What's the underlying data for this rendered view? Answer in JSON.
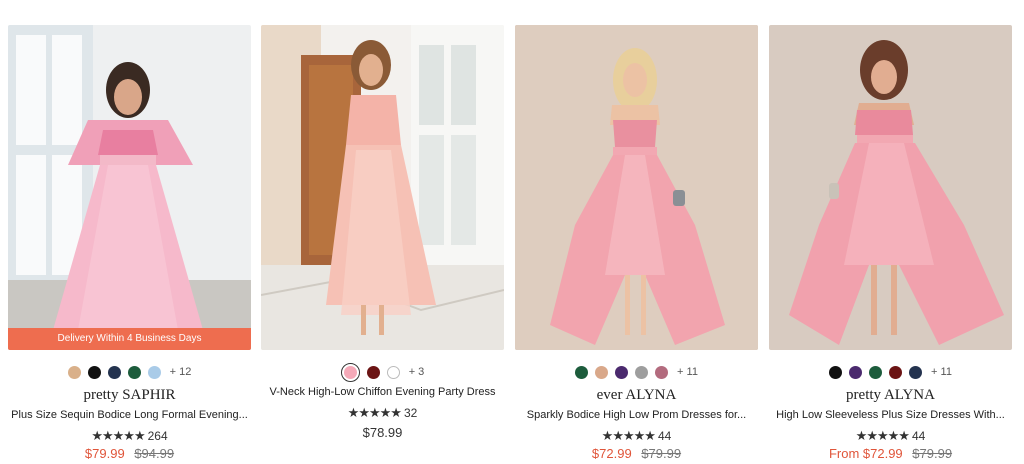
{
  "products": [
    {
      "brand": "pretty SAPHIR",
      "name": "Plus Size Sequin Bodice Long Formal Evening...",
      "rating_stars": "★★★★★",
      "review_count": "264",
      "sale_price": "$79.99",
      "original_price": "$94.99",
      "banner": "Delivery Within 4 Business Days",
      "more_colors": "+ 12",
      "swatches": [
        "#d9b08a",
        "#111111",
        "#24334f",
        "#1d5c3c",
        "#a9cbe8"
      ]
    },
    {
      "name": "V-Neck High-Low Chiffon Evening Party Dress",
      "rating_stars": "★★★★★",
      "review_count": "32",
      "price": "$78.99",
      "more_colors": "+ 3",
      "selected_swatch": "#f5a9b8",
      "swatches": [
        "#6b1414",
        "#ffffff"
      ]
    },
    {
      "brand": "ever ALYNA",
      "name": "Sparkly Bodice High Low Prom Dresses for...",
      "rating_stars": "★★★★★",
      "review_count": "44",
      "sale_price": "$72.99",
      "original_price": "$79.99",
      "more_colors": "+ 11",
      "swatches": [
        "#1d5c3c",
        "#d9a88a",
        "#4b2a6e",
        "#9e9e9e",
        "#b36b7e"
      ]
    },
    {
      "brand": "pretty ALYNA",
      "name": "High Low Sleeveless Plus Size Dresses With...",
      "rating_stars": "★★★★★",
      "review_count": "44",
      "sale_price": "From $72.99",
      "original_price": "$79.99",
      "more_colors": "+ 11",
      "swatches": [
        "#111111",
        "#4b2a6e",
        "#1d5c3c",
        "#6b1414",
        "#24334f"
      ]
    }
  ],
  "colors": {
    "sale": "#e0553a",
    "banner": "#ee6d4f"
  }
}
